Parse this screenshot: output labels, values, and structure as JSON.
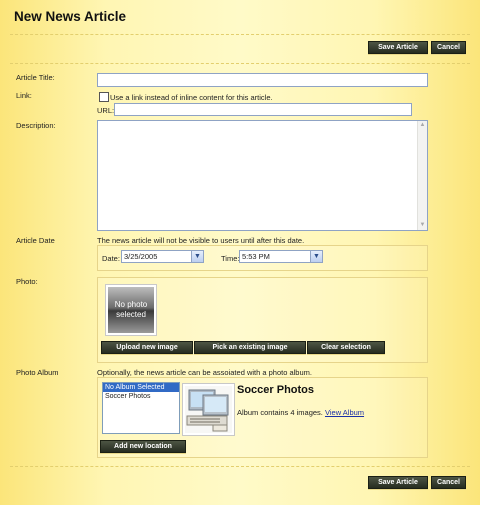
{
  "page": {
    "title": "New News Article"
  },
  "toolbar": {
    "save_label": "Save Article",
    "cancel_label": "Cancel"
  },
  "form": {
    "article_title_label": "Article Title:",
    "article_title_value": "",
    "link_label": "Link:",
    "use_link_label": "Use a link instead of inline content for this article.",
    "use_link_checked": false,
    "url_label": "URL:",
    "url_value": "",
    "description_label": "Description:",
    "description_value": "",
    "article_date_label": "Article Date",
    "date_note": "The news article will not be visible to users until after this date.",
    "date_label": "Date:",
    "date_value": "3/25/2005",
    "time_label": "Time:",
    "time_value": "5:53 PM",
    "photo_label": "Photo:",
    "no_photo_text": "No photo selected",
    "upload_label": "Upload new image",
    "pick_label": "Pick an existing image",
    "clear_label": "Clear selection",
    "album_label": "Photo Album",
    "album_note": "Optionally, the news article can be assoiated with a photo album.",
    "album_options": [
      "No Album Selected",
      "Soccer Photos"
    ],
    "album_selected": "No Album Selected",
    "album_name": "Soccer Photos",
    "album_count_text": "Album contains 4 images.",
    "view_album_label": "View Album",
    "add_location_label": "Add new location"
  },
  "icons": {
    "dropdown": "chevron-down-icon",
    "scroll_up": "arrow-up-icon",
    "scroll_down": "arrow-down-icon"
  },
  "colors": {
    "button_bg": "#2f3528",
    "link": "#1a2fa8",
    "selection": "#316ac5"
  }
}
